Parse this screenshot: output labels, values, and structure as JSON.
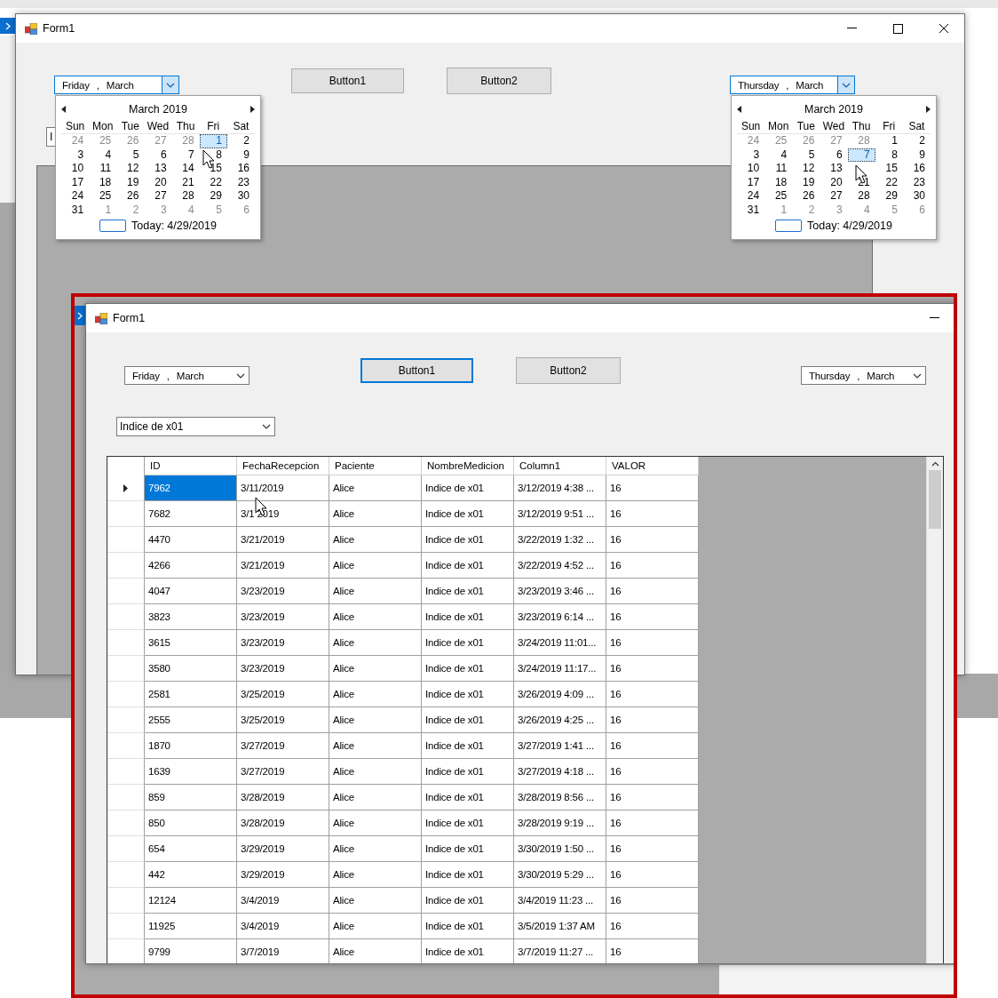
{
  "back_window": {
    "title": "Form1",
    "date_pickers": [
      {
        "day": "Friday",
        "separator": ",",
        "month": "March",
        "open": true,
        "calendar": {
          "title": "March 2019",
          "weekdays": [
            "Sun",
            "Mon",
            "Tue",
            "Wed",
            "Thu",
            "Fri",
            "Sat"
          ],
          "today": "Today: 4/29/2019",
          "weeks": [
            [
              {
                "d": "24",
                "other": true,
                "selected": false
              },
              {
                "d": "25",
                "other": true,
                "selected": false
              },
              {
                "d": "26",
                "other": true,
                "selected": false
              },
              {
                "d": "27",
                "other": true,
                "selected": false
              },
              {
                "d": "28",
                "other": true,
                "selected": false
              },
              {
                "d": "1",
                "other": false,
                "selected": true
              },
              {
                "d": "2",
                "other": false,
                "selected": false
              }
            ],
            [
              {
                "d": "3",
                "other": false,
                "selected": false
              },
              {
                "d": "4",
                "other": false,
                "selected": false
              },
              {
                "d": "5",
                "other": false,
                "selected": false
              },
              {
                "d": "6",
                "other": false,
                "selected": false
              },
              {
                "d": "7",
                "other": false,
                "selected": false
              },
              {
                "d": "8",
                "other": false,
                "selected": false
              },
              {
                "d": "9",
                "other": false,
                "selected": false
              }
            ],
            [
              {
                "d": "10",
                "other": false,
                "selected": false
              },
              {
                "d": "11",
                "other": false,
                "selected": false
              },
              {
                "d": "12",
                "other": false,
                "selected": false
              },
              {
                "d": "13",
                "other": false,
                "selected": false
              },
              {
                "d": "14",
                "other": false,
                "selected": false
              },
              {
                "d": "15",
                "other": false,
                "selected": false
              },
              {
                "d": "16",
                "other": false,
                "selected": false
              }
            ],
            [
              {
                "d": "17",
                "other": false,
                "selected": false
              },
              {
                "d": "18",
                "other": false,
                "selected": false
              },
              {
                "d": "19",
                "other": false,
                "selected": false
              },
              {
                "d": "20",
                "other": false,
                "selected": false
              },
              {
                "d": "21",
                "other": false,
                "selected": false
              },
              {
                "d": "22",
                "other": false,
                "selected": false
              },
              {
                "d": "23",
                "other": false,
                "selected": false
              }
            ],
            [
              {
                "d": "24",
                "other": false,
                "selected": false
              },
              {
                "d": "25",
                "other": false,
                "selected": false
              },
              {
                "d": "26",
                "other": false,
                "selected": false
              },
              {
                "d": "27",
                "other": false,
                "selected": false
              },
              {
                "d": "28",
                "other": false,
                "selected": false
              },
              {
                "d": "29",
                "other": false,
                "selected": false
              },
              {
                "d": "30",
                "other": false,
                "selected": false
              }
            ],
            [
              {
                "d": "31",
                "other": false,
                "selected": false
              },
              {
                "d": "1",
                "other": true,
                "selected": false
              },
              {
                "d": "2",
                "other": true,
                "selected": false
              },
              {
                "d": "3",
                "other": true,
                "selected": false
              },
              {
                "d": "4",
                "other": true,
                "selected": false
              },
              {
                "d": "5",
                "other": true,
                "selected": false
              },
              {
                "d": "6",
                "other": true,
                "selected": false
              }
            ]
          ]
        }
      },
      {
        "day": "Thursday",
        "separator": ",",
        "month": "March",
        "open": true,
        "calendar": {
          "title": "March 2019",
          "weekdays": [
            "Sun",
            "Mon",
            "Tue",
            "Wed",
            "Thu",
            "Fri",
            "Sat"
          ],
          "today": "Today: 4/29/2019",
          "weeks": [
            [
              {
                "d": "24",
                "other": true,
                "selected": false
              },
              {
                "d": "25",
                "other": true,
                "selected": false
              },
              {
                "d": "26",
                "other": true,
                "selected": false
              },
              {
                "d": "27",
                "other": true,
                "selected": false
              },
              {
                "d": "28",
                "other": true,
                "selected": false
              },
              {
                "d": "1",
                "other": false,
                "selected": false
              },
              {
                "d": "2",
                "other": false,
                "selected": false
              }
            ],
            [
              {
                "d": "3",
                "other": false,
                "selected": false
              },
              {
                "d": "4",
                "other": false,
                "selected": false
              },
              {
                "d": "5",
                "other": false,
                "selected": false
              },
              {
                "d": "6",
                "other": false,
                "selected": false
              },
              {
                "d": "7",
                "other": false,
                "selected": true
              },
              {
                "d": "8",
                "other": false,
                "selected": false
              },
              {
                "d": "9",
                "other": false,
                "selected": false
              }
            ],
            [
              {
                "d": "10",
                "other": false,
                "selected": false
              },
              {
                "d": "11",
                "other": false,
                "selected": false
              },
              {
                "d": "12",
                "other": false,
                "selected": false
              },
              {
                "d": "13",
                "other": false,
                "selected": false
              },
              {
                "other": false,
                "selected": false
              },
              {
                "d": "15",
                "other": false,
                "selected": false
              },
              {
                "d": "16",
                "other": false,
                "selected": false
              }
            ],
            [
              {
                "d": "17",
                "other": false,
                "selected": false
              },
              {
                "d": "18",
                "other": false,
                "selected": false
              },
              {
                "d": "19",
                "other": false,
                "selected": false
              },
              {
                "d": "20",
                "other": false,
                "selected": false
              },
              {
                "d": "21",
                "other": false,
                "selected": false
              },
              {
                "d": "22",
                "other": false,
                "selected": false
              },
              {
                "d": "23",
                "other": false,
                "selected": false
              }
            ],
            [
              {
                "d": "24",
                "other": false,
                "selected": false
              },
              {
                "d": "25",
                "other": false,
                "selected": false
              },
              {
                "d": "26",
                "other": false,
                "selected": false
              },
              {
                "d": "27",
                "other": false,
                "selected": false
              },
              {
                "d": "28",
                "other": false,
                "selected": false
              },
              {
                "d": "29",
                "other": false,
                "selected": false
              },
              {
                "d": "30",
                "other": false,
                "selected": false
              }
            ],
            [
              {
                "d": "31",
                "other": false,
                "selected": false
              },
              {
                "d": "1",
                "other": true,
                "selected": false
              },
              {
                "d": "2",
                "other": true,
                "selected": false
              },
              {
                "d": "3",
                "other": true,
                "selected": false
              },
              {
                "d": "4",
                "other": true,
                "selected": false
              },
              {
                "d": "5",
                "other": true,
                "selected": false
              },
              {
                "d": "6",
                "other": true,
                "selected": false
              }
            ]
          ]
        }
      }
    ],
    "buttons": [
      {
        "label": "Button1",
        "focused": false
      },
      {
        "label": "Button2",
        "focused": false
      }
    ],
    "combo": {
      "value": "I"
    }
  },
  "front_window": {
    "title": "Form1",
    "date_pickers": [
      {
        "day": "Friday",
        "separator": ",",
        "month": "March",
        "open": false
      },
      {
        "day": "Thursday",
        "separator": ",",
        "month": "March",
        "open": false
      }
    ],
    "buttons": [
      {
        "label": "Button1",
        "focused": true
      },
      {
        "label": "Button2",
        "focused": false
      }
    ],
    "combo": {
      "value": "Indice de x01"
    },
    "table": {
      "columns": [
        "ID",
        "FechaRecepcion",
        "Paciente",
        "NombreMedicion",
        "Column1",
        "VALOR"
      ],
      "rows": [
        {
          "selected": true,
          "cells": [
            "7962",
            "3/11/2019",
            "Alice",
            "Indice de x01",
            "3/12/2019 4:38 ...",
            "16"
          ]
        },
        {
          "selected": false,
          "cells": [
            "7682",
            "3/1   2019",
            "Alice",
            "Indice de x01",
            "3/12/2019 9:51 ...",
            "16"
          ]
        },
        {
          "selected": false,
          "cells": [
            "4470",
            "3/21/2019",
            "Alice",
            "Indice de x01",
            "3/22/2019 1:32 ...",
            "16"
          ]
        },
        {
          "selected": false,
          "cells": [
            "4266",
            "3/21/2019",
            "Alice",
            "Indice de x01",
            "3/22/2019 4:52 ...",
            "16"
          ]
        },
        {
          "selected": false,
          "cells": [
            "4047",
            "3/23/2019",
            "Alice",
            "Indice de x01",
            "3/23/2019 3:46 ...",
            "16"
          ]
        },
        {
          "selected": false,
          "cells": [
            "3823",
            "3/23/2019",
            "Alice",
            "Indice de x01",
            "3/23/2019 6:14 ...",
            "16"
          ]
        },
        {
          "selected": false,
          "cells": [
            "3615",
            "3/23/2019",
            "Alice",
            "Indice de x01",
            "3/24/2019 11:01...",
            "16"
          ]
        },
        {
          "selected": false,
          "cells": [
            "3580",
            "3/23/2019",
            "Alice",
            "Indice de x01",
            "3/24/2019 11:17...",
            "16"
          ]
        },
        {
          "selected": false,
          "cells": [
            "2581",
            "3/25/2019",
            "Alice",
            "Indice de x01",
            "3/26/2019 4:09 ...",
            "16"
          ]
        },
        {
          "selected": false,
          "cells": [
            "2555",
            "3/25/2019",
            "Alice",
            "Indice de x01",
            "3/26/2019 4:25 ...",
            "16"
          ]
        },
        {
          "selected": false,
          "cells": [
            "1870",
            "3/27/2019",
            "Alice",
            "Indice de x01",
            "3/27/2019 1:41 ...",
            "16"
          ]
        },
        {
          "selected": false,
          "cells": [
            "1639",
            "3/27/2019",
            "Alice",
            "Indice de x01",
            "3/27/2019 4:18 ...",
            "16"
          ]
        },
        {
          "selected": false,
          "cells": [
            "859",
            "3/28/2019",
            "Alice",
            "Indice de x01",
            "3/28/2019 8:56 ...",
            "16"
          ]
        },
        {
          "selected": false,
          "cells": [
            "850",
            "3/28/2019",
            "Alice",
            "Indice de x01",
            "3/28/2019 9:19 ...",
            "16"
          ]
        },
        {
          "selected": false,
          "cells": [
            "654",
            "3/29/2019",
            "Alice",
            "Indice de x01",
            "3/30/2019 1:50 ...",
            "16"
          ]
        },
        {
          "selected": false,
          "cells": [
            "442",
            "3/29/2019",
            "Alice",
            "Indice de x01",
            "3/30/2019 5:29 ...",
            "16"
          ]
        },
        {
          "selected": false,
          "cells": [
            "12124",
            "3/4/2019",
            "Alice",
            "Indice de x01",
            "3/4/2019 11:23 ...",
            "16"
          ]
        },
        {
          "selected": false,
          "cells": [
            "11925",
            "3/4/2019",
            "Alice",
            "Indice de x01",
            "3/5/2019 1:37 AM",
            "16"
          ]
        },
        {
          "selected": false,
          "cells": [
            "9799",
            "3/7/2019",
            "Alice",
            "Indice de x01",
            "3/7/2019 11:27 ...",
            "16"
          ]
        }
      ]
    }
  }
}
